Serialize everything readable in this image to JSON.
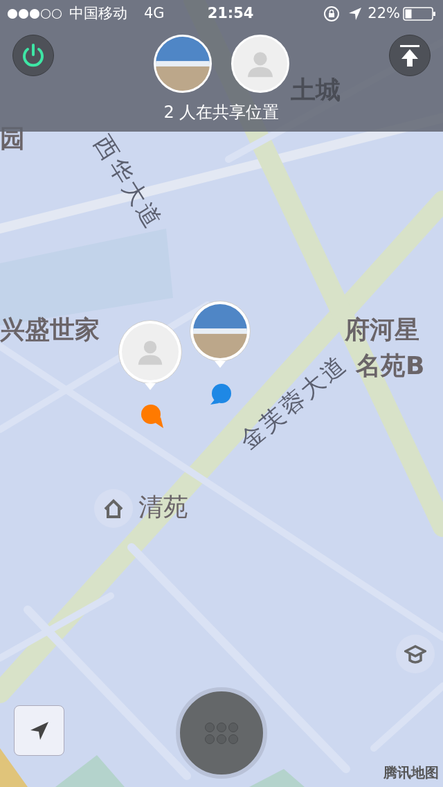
{
  "status_bar": {
    "carrier": "中国移动",
    "network": "4G",
    "time": "21:54",
    "battery": "22%"
  },
  "header": {
    "members": [
      {
        "kind": "photo"
      },
      {
        "kind": "default"
      }
    ],
    "caption": "2 人在共享位置"
  },
  "map": {
    "labels": [
      {
        "text": "土城",
        "kind": "area"
      },
      {
        "text": "园",
        "kind": "area"
      },
      {
        "text": "西华大道",
        "kind": "road"
      },
      {
        "text": "兴盛世家",
        "kind": "area"
      },
      {
        "text": "金芙蓉大道",
        "kind": "road"
      },
      {
        "text": "府河星",
        "kind": "area"
      },
      {
        "text": "名苑B",
        "kind": "area"
      }
    ],
    "pois": [
      {
        "kind": "home",
        "text": "清苑"
      },
      {
        "kind": "school"
      }
    ],
    "markers": [
      {
        "kind": "default",
        "color": "#ff7a00"
      },
      {
        "kind": "photo",
        "color": "#1e88e5"
      }
    ],
    "attribution": "腾讯地图"
  }
}
